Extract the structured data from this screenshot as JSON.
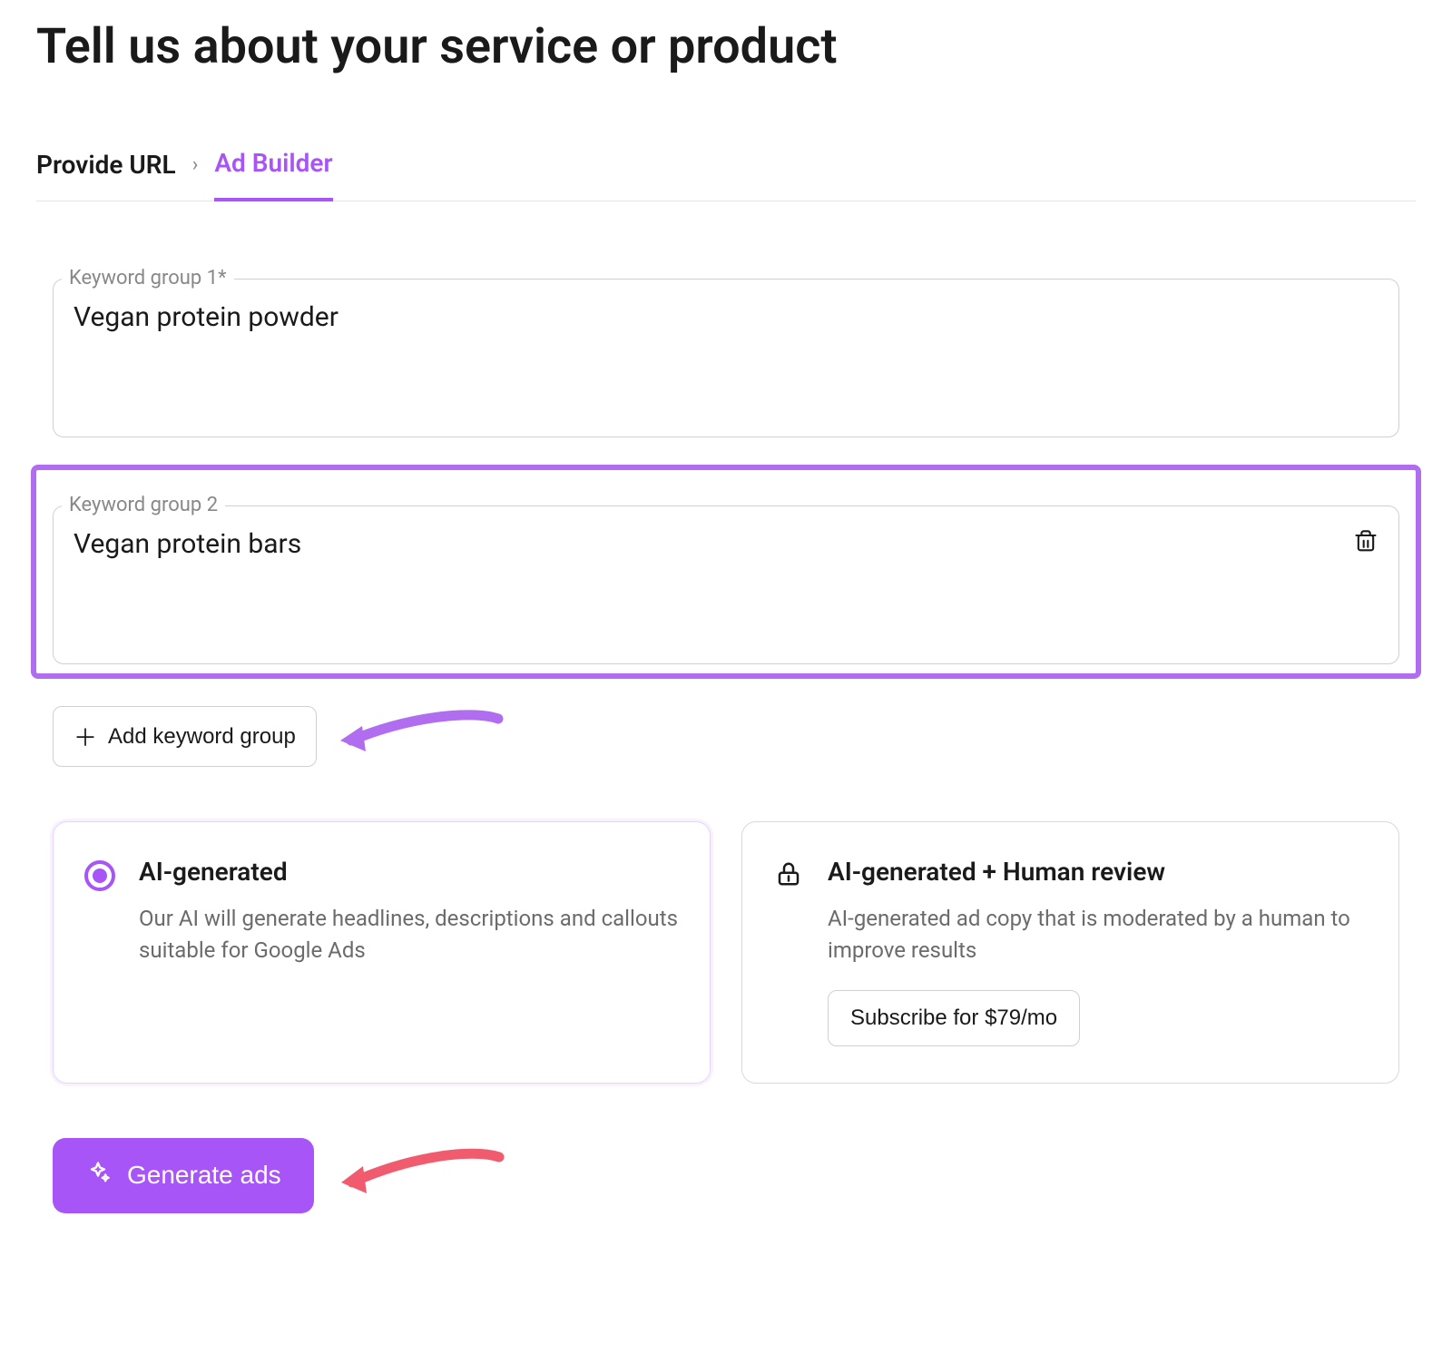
{
  "title": "Tell us about your service or product",
  "breadcrumb": {
    "step1": "Provide URL",
    "step2": "Ad Builder"
  },
  "keyword_groups": [
    {
      "label": "Keyword group 1*",
      "value": "Vegan protein powder",
      "deletable": false
    },
    {
      "label": "Keyword group 2",
      "value": "Vegan protein bars",
      "deletable": true
    }
  ],
  "add_keyword_label": "Add keyword group",
  "options": {
    "ai": {
      "title": "AI-generated",
      "desc": "Our AI will generate headlines, descriptions and callouts suitable for Google Ads"
    },
    "human": {
      "title": "AI-generated + Human review",
      "desc": "AI-generated ad copy that is moderated by a human to improve results",
      "subscribe_label": "Subscribe for $79/mo"
    }
  },
  "generate_label": "Generate ads",
  "colors": {
    "accent": "#a855f7",
    "highlight": "#b06df0",
    "arrow_red": "#f05c6e"
  }
}
